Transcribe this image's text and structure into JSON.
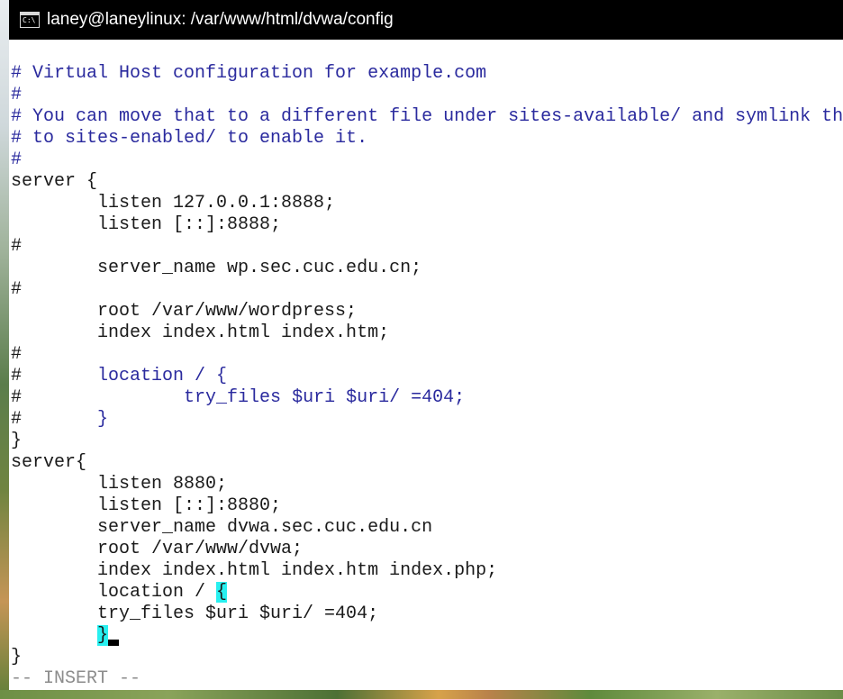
{
  "window": {
    "title": "laney@laneylinux: /var/www/html/dvwa/config",
    "icon": {
      "name": "console-icon",
      "glyph": "C:\\"
    }
  },
  "colors": {
    "titlebar": "#000000",
    "text": "#1a1a1a",
    "comment": "#2a2a9e",
    "match_bg": "#28f0f0",
    "mode": "#8c8c8c",
    "cursor": "#000000"
  },
  "editor": {
    "lines": [
      {
        "segments": [
          {
            "text": "# Virtual Host configuration for example.com",
            "style": "comment"
          }
        ]
      },
      {
        "segments": [
          {
            "text": "#",
            "style": "comment"
          }
        ]
      },
      {
        "segments": [
          {
            "text": "# You can move that to a different file under sites-available/ and symlink th",
            "style": "comment"
          }
        ]
      },
      {
        "segments": [
          {
            "text": "# to sites-enabled/ to enable it.",
            "style": "comment"
          }
        ]
      },
      {
        "segments": [
          {
            "text": "#",
            "style": "comment"
          }
        ]
      },
      {
        "segments": [
          {
            "text": "server {",
            "style": "plain"
          }
        ]
      },
      {
        "segments": [
          {
            "text": "        listen 127.0.0.1:8888;",
            "style": "plain"
          }
        ]
      },
      {
        "segments": [
          {
            "text": "        listen [::]:8888;",
            "style": "plain"
          }
        ]
      },
      {
        "segments": [
          {
            "text": "#",
            "style": "hash"
          }
        ]
      },
      {
        "segments": [
          {
            "text": "        server_name wp.sec.cuc.edu.cn;",
            "style": "plain"
          }
        ]
      },
      {
        "segments": [
          {
            "text": "#",
            "style": "hash"
          }
        ]
      },
      {
        "segments": [
          {
            "text": "        root /var/www/wordpress;",
            "style": "plain"
          }
        ]
      },
      {
        "segments": [
          {
            "text": "        index index.html index.htm;",
            "style": "plain"
          }
        ]
      },
      {
        "segments": [
          {
            "text": "#",
            "style": "hash"
          }
        ]
      },
      {
        "segments": [
          {
            "text": "#",
            "style": "hash"
          },
          {
            "text": "       location / {",
            "style": "comment"
          }
        ]
      },
      {
        "segments": [
          {
            "text": "#",
            "style": "hash"
          },
          {
            "text": "               try_files $uri $uri/ =404;",
            "style": "comment"
          }
        ]
      },
      {
        "segments": [
          {
            "text": "#",
            "style": "hash"
          },
          {
            "text": "       }",
            "style": "comment"
          }
        ]
      },
      {
        "segments": [
          {
            "text": "}",
            "style": "plain"
          }
        ]
      },
      {
        "segments": [
          {
            "text": "server{",
            "style": "plain"
          }
        ]
      },
      {
        "segments": [
          {
            "text": "        listen 8880;",
            "style": "plain"
          }
        ]
      },
      {
        "segments": [
          {
            "text": "        listen [::]:8880;",
            "style": "plain"
          }
        ]
      },
      {
        "segments": [
          {
            "text": "        server_name dvwa.sec.cuc.edu.cn",
            "style": "plain"
          }
        ]
      },
      {
        "segments": [
          {
            "text": "        root /var/www/dvwa;",
            "style": "plain"
          }
        ]
      },
      {
        "segments": [
          {
            "text": "        index index.html index.htm index.php;",
            "style": "plain"
          }
        ]
      },
      {
        "segments": [
          {
            "text": "        location / ",
            "style": "plain"
          },
          {
            "text": "{",
            "style": "match"
          }
        ]
      },
      {
        "segments": [
          {
            "text": "        try_files $uri $uri/ =404;",
            "style": "plain"
          }
        ]
      },
      {
        "segments": [
          {
            "text": "        ",
            "style": "plain"
          },
          {
            "text": "}",
            "style": "match"
          }
        ],
        "cursor": true
      },
      {
        "segments": [
          {
            "text": "}",
            "style": "plain"
          }
        ]
      }
    ],
    "mode_text": "-- INSERT --"
  }
}
